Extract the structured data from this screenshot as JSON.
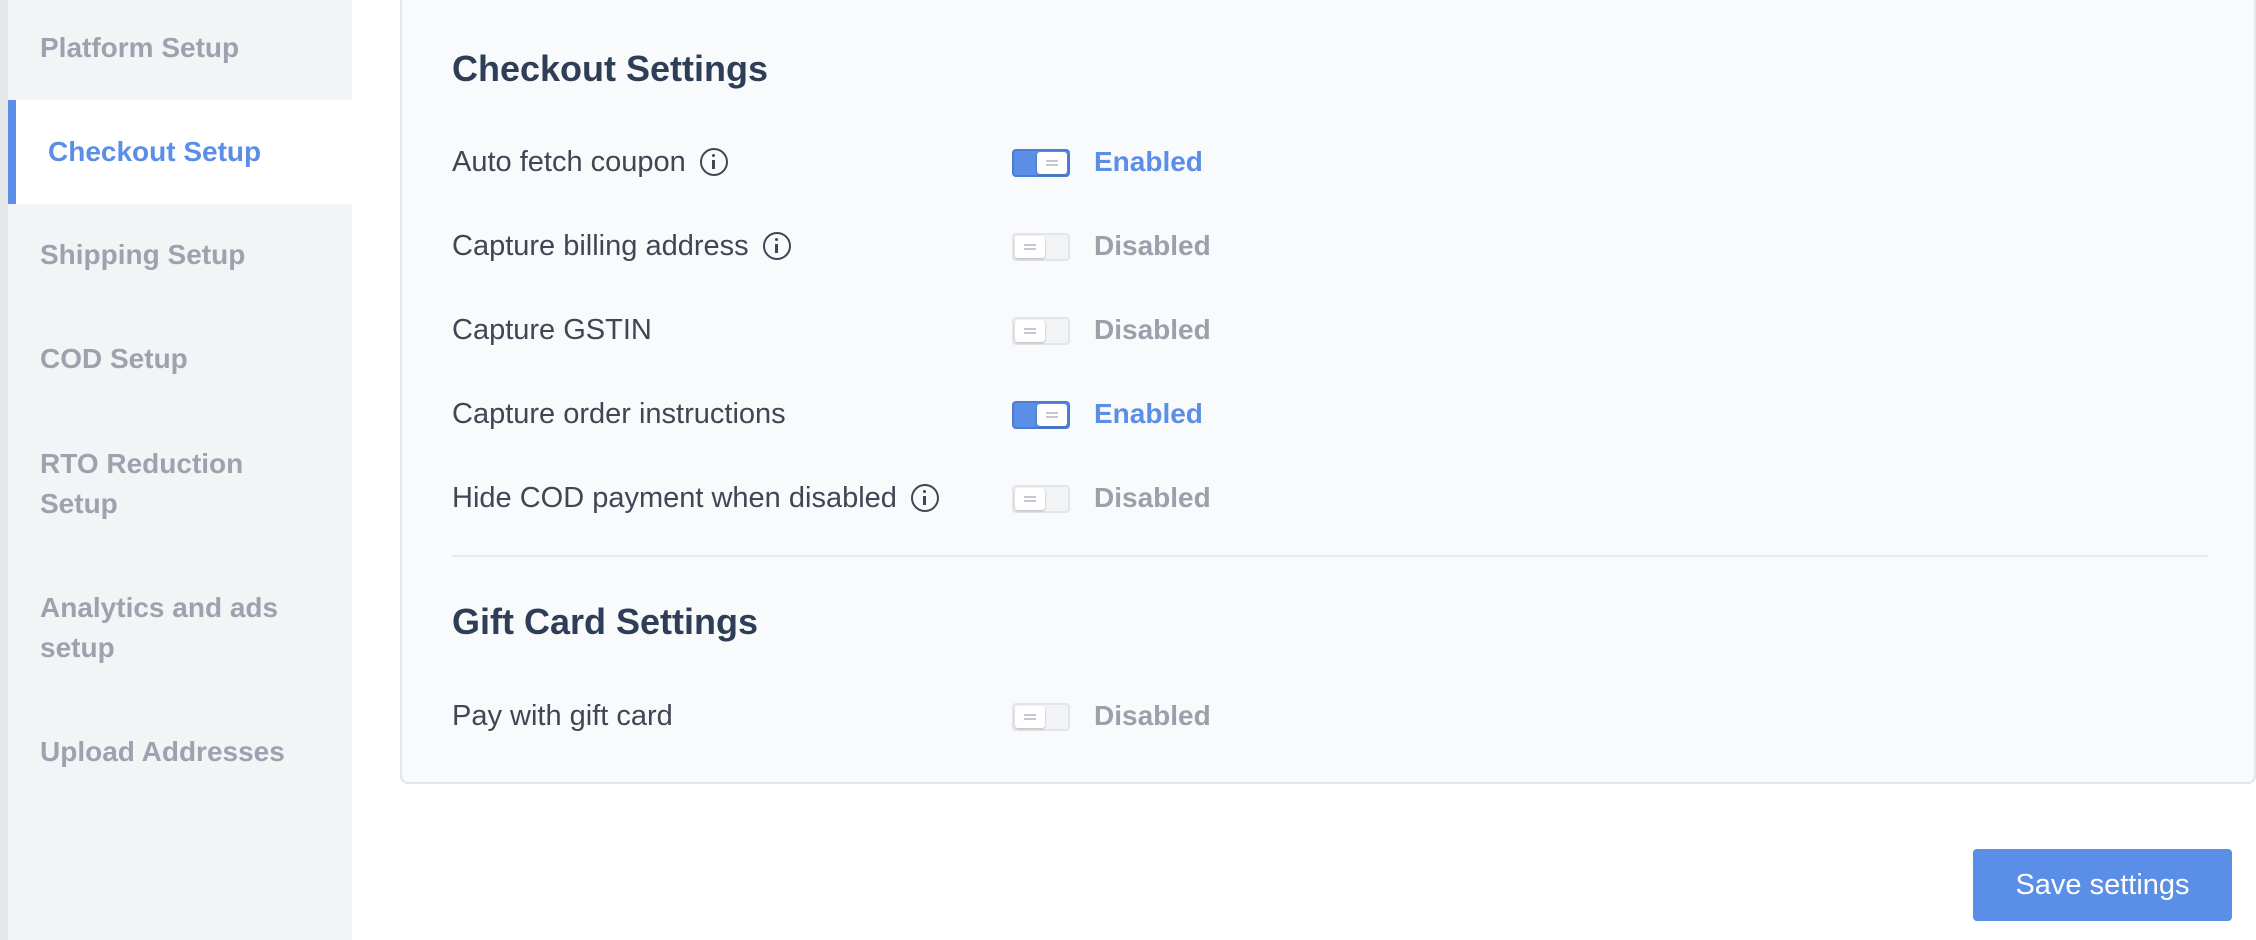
{
  "sidebar": {
    "items": [
      {
        "label": "Platform Setup"
      },
      {
        "label": "Checkout Setup"
      },
      {
        "label": "Shipping Setup"
      },
      {
        "label": "COD Setup"
      },
      {
        "label": "RTO Reduction Setup"
      },
      {
        "label": "Analytics and ads setup"
      },
      {
        "label": "Upload Addresses"
      }
    ],
    "active_item": "Checkout Setup"
  },
  "checkout": {
    "title": "Checkout Settings",
    "rows": [
      {
        "label": "Auto fetch coupon",
        "has_info": true,
        "enabled": true,
        "status": "Enabled"
      },
      {
        "label": "Capture billing address",
        "has_info": true,
        "enabled": false,
        "status": "Disabled"
      },
      {
        "label": "Capture GSTIN",
        "has_info": false,
        "enabled": false,
        "status": "Disabled"
      },
      {
        "label": "Capture order instructions",
        "has_info": false,
        "enabled": true,
        "status": "Enabled"
      },
      {
        "label": "Hide COD payment when disabled",
        "has_info": true,
        "enabled": false,
        "status": "Disabled"
      }
    ]
  },
  "gift_card": {
    "title": "Gift Card Settings",
    "rows": [
      {
        "label": "Pay with gift card",
        "has_info": false,
        "enabled": false,
        "status": "Disabled"
      }
    ]
  },
  "actions": {
    "save_label": "Save settings"
  },
  "colors": {
    "accent": "#5b8ee6",
    "muted": "#9ca3af",
    "heading": "#2f3e57"
  },
  "icons": {
    "info": "info-circle-icon"
  }
}
